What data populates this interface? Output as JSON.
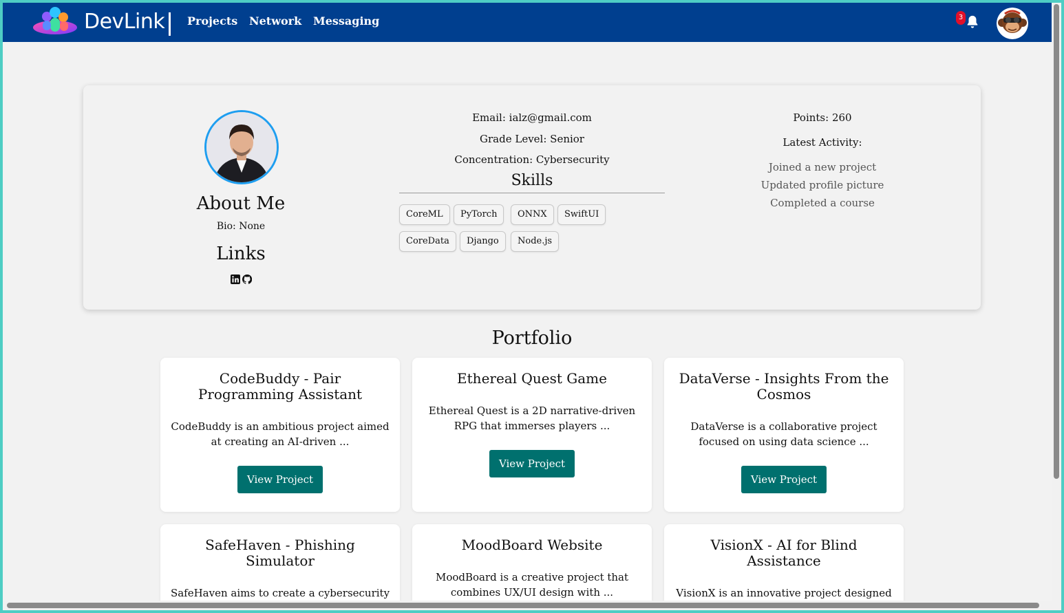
{
  "nav": {
    "brand": "DevLink",
    "links": [
      "Projects",
      "Network",
      "Messaging"
    ],
    "notification_count": "3",
    "colors": {
      "bar": "#003f8f",
      "badge": "#e0102a"
    }
  },
  "profile": {
    "about_title": "About Me",
    "bio": "Bio: None",
    "links_title": "Links",
    "link_icons": [
      "linkedin-icon",
      "github-icon"
    ],
    "email": "Email: ialz@gmail.com",
    "grade": "Grade Level: Senior",
    "concentration": "Concentration: Cybersecurity",
    "skills_title": "Skills",
    "skills": [
      "CoreML",
      "PyTorch",
      "ONNX",
      "SwiftUI",
      "CoreData",
      "Django",
      "Node.js"
    ],
    "points": "Points: 260",
    "activity_title": "Latest Activity:",
    "activity": [
      "Joined a new project",
      "Updated profile picture",
      "Completed a course"
    ]
  },
  "portfolio": {
    "title": "Portfolio",
    "button_label": "View Project",
    "button_color": "#00706e",
    "projects": [
      {
        "title": "CodeBuddy - Pair Programming Assistant",
        "desc": "CodeBuddy is an ambitious project aimed at creating an AI-driven ..."
      },
      {
        "title": "Ethereal Quest Game",
        "desc": "Ethereal Quest is a 2D narrative-driven RPG that immerses players ..."
      },
      {
        "title": "DataVerse - Insights From the Cosmos",
        "desc": "DataVerse is a collaborative project focused on using data science ..."
      },
      {
        "title": "SafeHaven - Phishing Simulator",
        "desc": "SafeHaven aims to create a cybersecurity training platform that simulates ..."
      },
      {
        "title": "MoodBoard Website",
        "desc": "MoodBoard is a creative project that combines UX/UI design with ..."
      },
      {
        "title": "VisionX - AI for Blind Assistance",
        "desc": "VisionX is an innovative project designed to create a mobile ..."
      }
    ]
  }
}
